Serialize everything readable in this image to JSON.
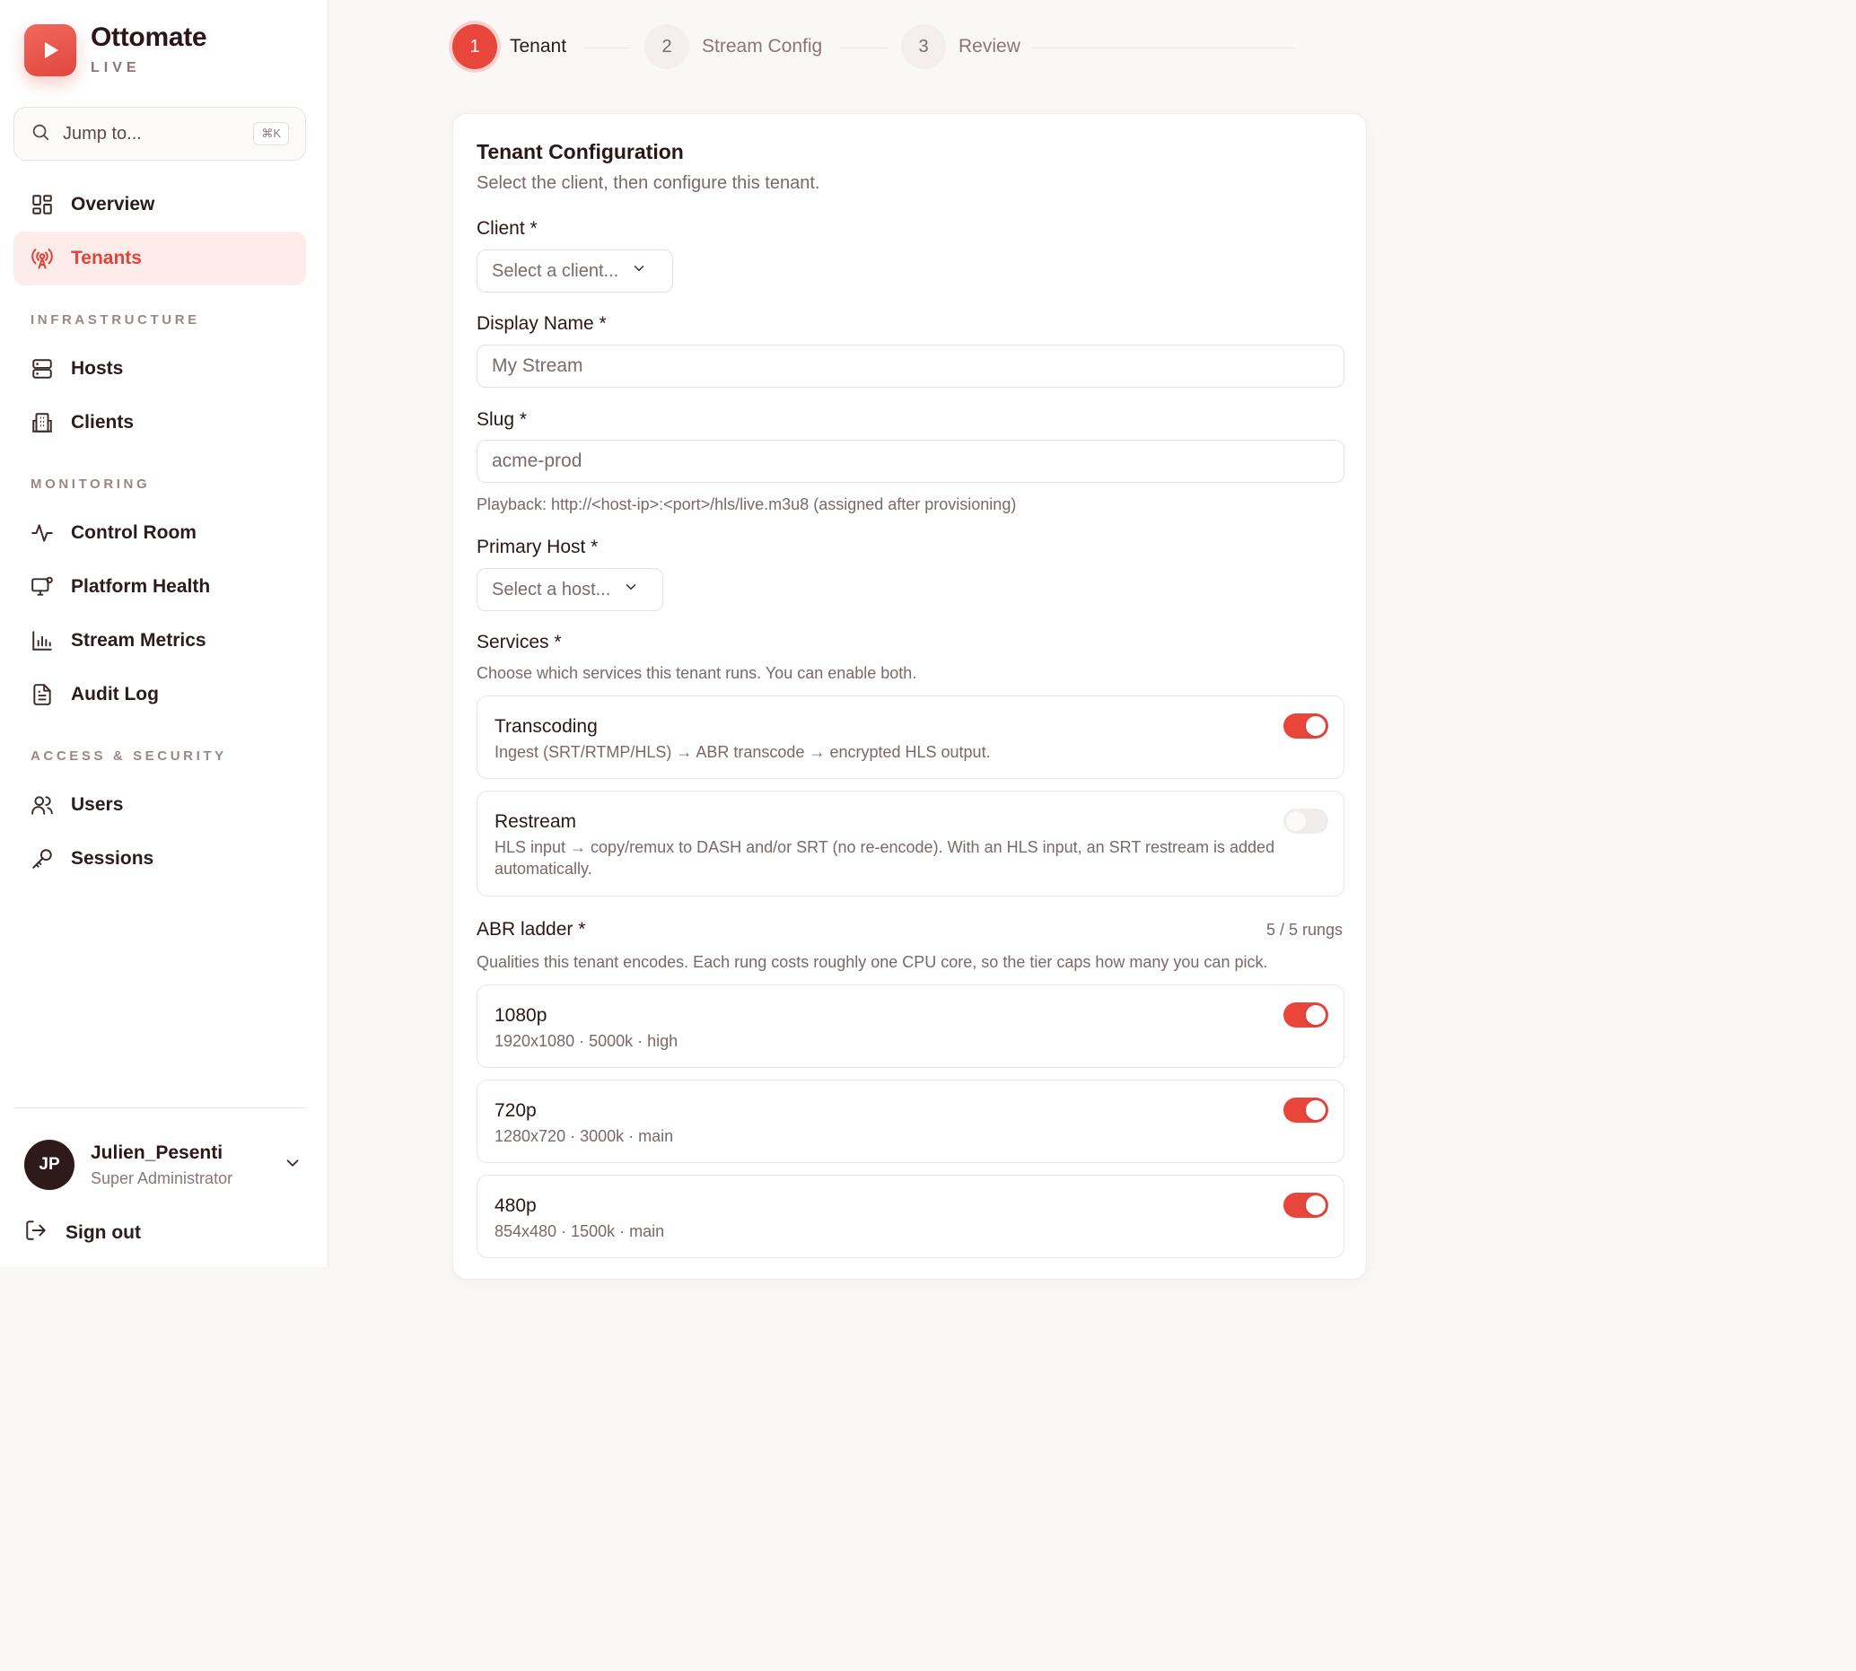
{
  "brand": {
    "name": "Ottomate",
    "sub": "LIVE"
  },
  "search": {
    "placeholder": "Jump to...",
    "shortcut": "⌘K"
  },
  "nav": {
    "overview": "Overview",
    "tenants": "Tenants",
    "section_infrastructure": "INFRASTRUCTURE",
    "hosts": "Hosts",
    "clients": "Clients",
    "section_monitoring": "MONITORING",
    "control_room": "Control Room",
    "platform_health": "Platform Health",
    "stream_metrics": "Stream Metrics",
    "audit_log": "Audit Log",
    "section_access": "ACCESS & SECURITY",
    "users": "Users",
    "sessions": "Sessions"
  },
  "user": {
    "initials": "JP",
    "name": "Julien_Pesenti",
    "role": "Super Administrator",
    "sign_out": "Sign out"
  },
  "stepper": [
    {
      "num": "1",
      "label": "Tenant",
      "active": true
    },
    {
      "num": "2",
      "label": "Stream Config",
      "active": false
    },
    {
      "num": "3",
      "label": "Review",
      "active": false
    }
  ],
  "form": {
    "title": "Tenant Configuration",
    "subtitle": "Select the client, then configure this tenant.",
    "client_label": "Client *",
    "client_value": "Select a client...",
    "display_name_label": "Display Name *",
    "display_name_placeholder": "My Stream",
    "slug_label": "Slug *",
    "slug_placeholder": "acme-prod",
    "playback_hint": "Playback: http://<host-ip>:<port>/hls/live.m3u8 (assigned after provisioning)",
    "primary_host_label": "Primary Host *",
    "primary_host_value": "Select a host...",
    "services_label": "Services *",
    "services_hint": "Choose which services this tenant runs. You can enable both.",
    "services": [
      {
        "title": "Transcoding",
        "desc": "Ingest (SRT/RTMP/HLS) → ABR transcode → encrypted HLS output.",
        "enabled": true
      },
      {
        "title": "Restream",
        "desc": "HLS input → copy/remux to DASH and/or SRT (no re-encode). With an HLS input, an SRT restream is added automatically.",
        "enabled": false
      }
    ],
    "abr_label": "ABR ladder *",
    "abr_count": "5 / 5 rungs",
    "abr_hint": "Qualities this tenant encodes. Each rung costs roughly one CPU core, so the tier caps how many you can pick.",
    "rungs": [
      {
        "title": "1080p",
        "desc": "1920x1080 · 5000k · high",
        "enabled": true
      },
      {
        "title": "720p",
        "desc": "1280x720 · 3000k · main",
        "enabled": true
      },
      {
        "title": "480p",
        "desc": "854x480 · 1500k · main",
        "enabled": true
      }
    ]
  },
  "colors": {
    "accent": "#e8453b",
    "accent_soft": "#fdecea",
    "text": "#2b1d1d",
    "muted": "#7b6868"
  }
}
